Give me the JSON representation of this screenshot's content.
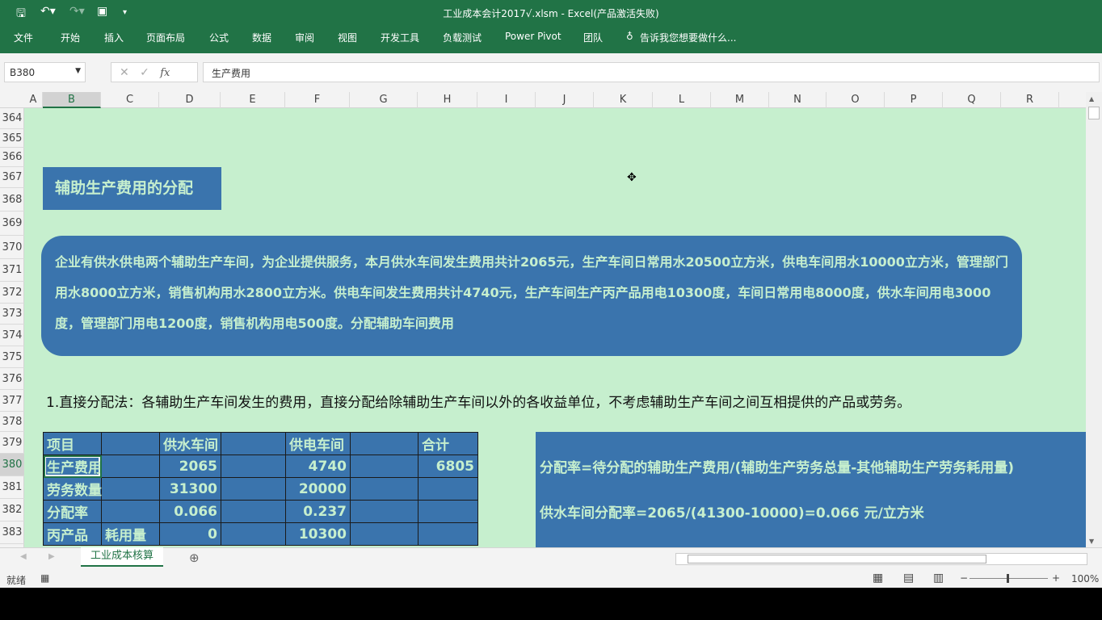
{
  "window": {
    "title": "工业成本会计2017√.xlsm - Excel(产品激活失败)"
  },
  "ribbon": {
    "tabs": [
      "文件",
      "开始",
      "插入",
      "页面布局",
      "公式",
      "数据",
      "审阅",
      "视图",
      "开发工具",
      "负载测试",
      "Power Pivot",
      "团队"
    ],
    "tell_me": "告诉我您想要做什么..."
  },
  "formula_bar": {
    "name_box": "B380",
    "formula": "生产费用",
    "fx": "fx"
  },
  "columns": [
    "A",
    "B",
    "C",
    "D",
    "E",
    "F",
    "G",
    "H",
    "I",
    "J",
    "K",
    "L",
    "M",
    "N",
    "O",
    "P",
    "Q",
    "R"
  ],
  "rows": [
    "364",
    "365",
    "366",
    "367",
    "368",
    "369",
    "370",
    "371",
    "372",
    "373",
    "374",
    "375",
    "376",
    "377",
    "378",
    "379",
    "380",
    "381",
    "382",
    "383"
  ],
  "sheet": {
    "heading": "辅助生产费用的分配",
    "description": "企业有供水供电两个辅助生产车间，为企业提供服务，本月供水车间发生费用共计2065元，生产车间日常用水20500立方米，供电车间用水10000立方米，管理部门用水8000立方米，销售机构用水2800立方米。供电车间发生费用共计4740元，生产车间生产丙产品用电10300度，车间日常用电8000度，供水车间用电3000度，管理部门用电1200度，销售机构用电500度。分配辅助车间费用",
    "method": "1.直接分配法：各辅助生产车间发生的费用，直接分配给除辅助生产车间以外的各收益单位，不考虑辅助生产车间之间互相提供的产品或劳务。",
    "table": [
      [
        "项目",
        "",
        "供水车间",
        "",
        "供电车间",
        "",
        "合计"
      ],
      [
        "生产费用",
        "",
        "2065",
        "",
        "4740",
        "",
        "6805"
      ],
      [
        "劳务数量",
        "",
        "31300",
        "",
        "20000",
        "",
        ""
      ],
      [
        "分配率",
        "",
        "0.066",
        "",
        "0.237",
        "",
        ""
      ],
      [
        "丙产品",
        "耗用量",
        "0",
        "",
        "10300",
        "",
        ""
      ]
    ],
    "formula1": "分配率=待分配的辅助生产费用/(辅助生产劳务总量-其他辅助生产劳务耗用量)",
    "formula2": "供水车间分配率=2065/(41300-10000)=0.066 元/立方米"
  },
  "sheet_tab": "工业成本核算",
  "status": {
    "ready": "就绪",
    "zoom": "100%"
  },
  "colors": {
    "green": "#217346",
    "sheet_bg": "#c6efce",
    "box_blue": "#3a74ad"
  }
}
